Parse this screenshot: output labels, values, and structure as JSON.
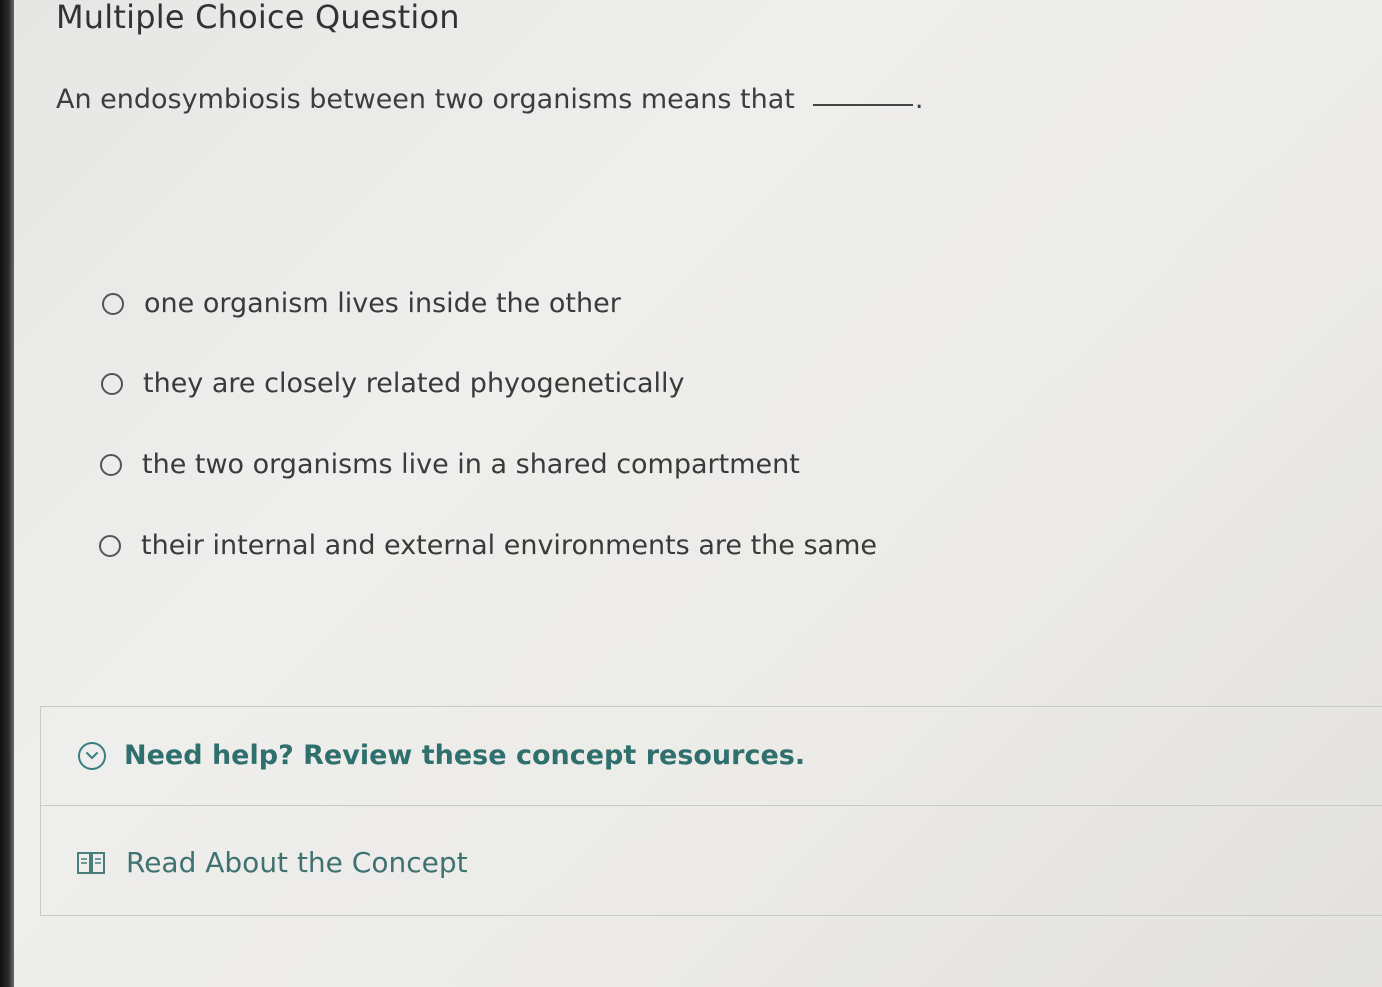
{
  "question": {
    "title": "Multiple Choice Question",
    "prompt": "An endosymbiosis between two organisms means that",
    "blank_suffix": "."
  },
  "options": [
    {
      "label": "one organism lives inside the other",
      "selected": false
    },
    {
      "label": "they are closely related phyogenetically",
      "selected": false
    },
    {
      "label": "the two organisms live in a shared compartment",
      "selected": false
    },
    {
      "label": "their internal and external environments are the same",
      "selected": false
    }
  ],
  "help": {
    "header": "Need help? Review these concept resources.",
    "resource_label": "Read About the Concept",
    "header_icon": "chevron-down-circle-icon",
    "resource_icon": "book-icon"
  },
  "colors": {
    "accent": "#2f6f6d",
    "text": "#3a3a3a"
  }
}
